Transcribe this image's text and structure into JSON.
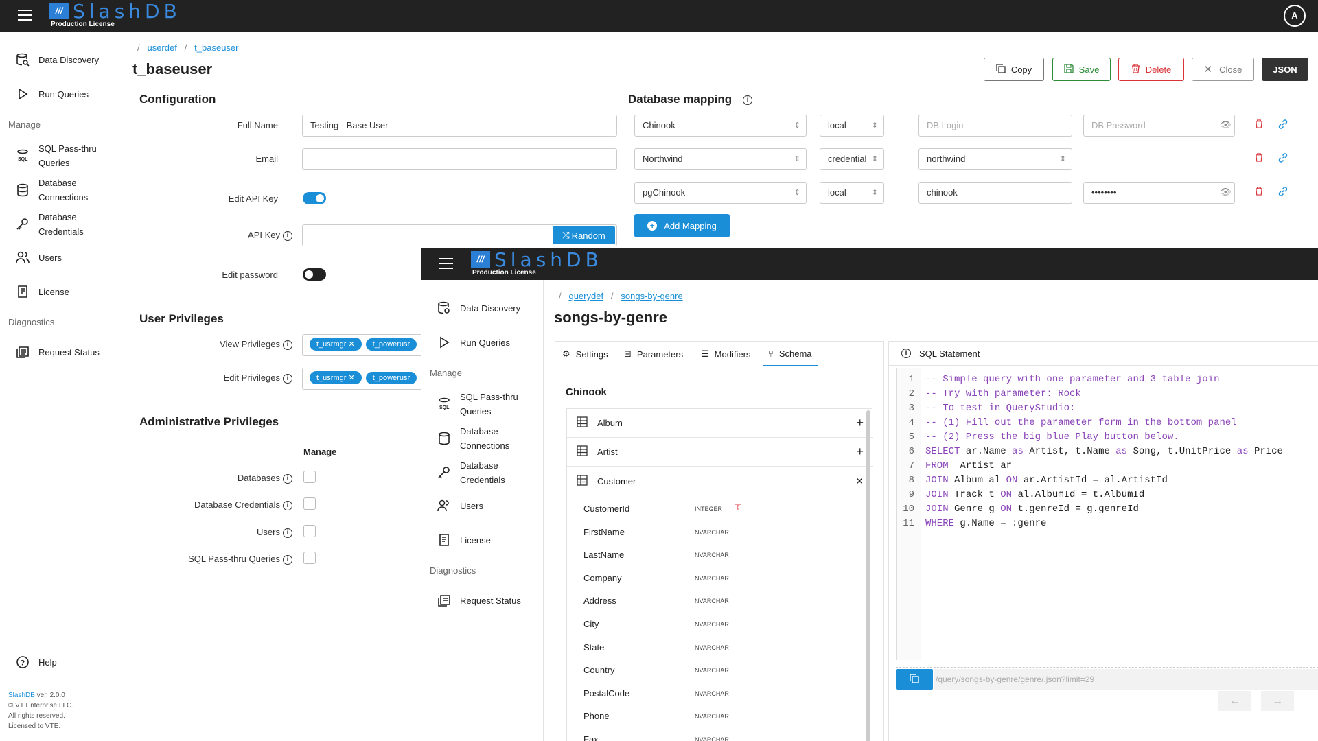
{
  "app": {
    "name": "SlashDB",
    "license": "Production License",
    "avatar": "A"
  },
  "sidebar": {
    "items": [
      {
        "label": "Data Discovery"
      },
      {
        "label": "Run Queries"
      },
      {
        "label": "SQL Pass-thru Queries"
      },
      {
        "label": "Database Connections"
      },
      {
        "label": "Database Credentials"
      },
      {
        "label": "Users"
      },
      {
        "label": "License"
      },
      {
        "label": "Request Status"
      },
      {
        "label": "Help"
      }
    ],
    "sections": {
      "manage": "Manage",
      "diagnostics": "Diagnostics"
    },
    "footer": {
      "product": "SlashDB",
      "version": " ver. 2.0.0",
      "copyright": "© VT Enterprise LLC.",
      "rights": "All rights reserved.",
      "licensed": "Licensed to VTE."
    }
  },
  "breadcrumb": {
    "sep": "/",
    "part1": "userdef",
    "part2": "t_baseuser"
  },
  "page_title": "t_baseuser",
  "toolbar": {
    "copy": "Copy",
    "save": "Save",
    "delete": "Delete",
    "close": "Close",
    "json": "JSON"
  },
  "config": {
    "heading": "Configuration",
    "full_name_label": "Full Name",
    "full_name_value": "Testing - Base User",
    "email_label": "Email",
    "email_value": "",
    "edit_api_key_label": "Edit API Key",
    "edit_api_key_on": true,
    "api_key_label": "API Key",
    "api_key_value": "",
    "random_label": "Random",
    "edit_password_label": "Edit password",
    "edit_password_on": false
  },
  "mapping": {
    "heading": "Database mapping",
    "rows": [
      {
        "db": "Chinook",
        "type": "local",
        "login": "",
        "login_ph": "DB Login",
        "password": "",
        "password_ph": "DB Password"
      },
      {
        "db": "Northwind",
        "type": "credential",
        "login": "northwind"
      },
      {
        "db": "pgChinook",
        "type": "local",
        "login": "chinook",
        "password": "••••••••"
      }
    ],
    "add_label": "Add Mapping"
  },
  "privileges": {
    "heading": "User Privileges",
    "view_label": "View Privileges",
    "edit_label": "Edit Privileges",
    "chips": [
      "t_usrmgr",
      "t_powerusr"
    ]
  },
  "admin": {
    "heading": "Administrative Privileges",
    "manage_col": "Manage",
    "rows": [
      {
        "label": "Databases",
        "checked": false
      },
      {
        "label": "Database Credentials",
        "checked": false
      },
      {
        "label": "Users",
        "checked": false
      },
      {
        "label": "SQL Pass-thru Queries",
        "checked": false
      }
    ]
  },
  "overlay": {
    "breadcrumb": {
      "sep": "/",
      "part1": "querydef",
      "part2": "songs-by-genre"
    },
    "title": "songs-by-genre",
    "tabs": [
      "Settings",
      "Parameters",
      "Modifiers",
      "Schema"
    ],
    "active_tab": "Schema",
    "schema": {
      "db": "Chinook",
      "tables": [
        "Album",
        "Artist",
        "Customer"
      ],
      "columns": [
        {
          "name": "CustomerId",
          "type": "INTEGER"
        },
        {
          "name": "FirstName",
          "type": "NVARCHAR"
        },
        {
          "name": "LastName",
          "type": "NVARCHAR"
        },
        {
          "name": "Company",
          "type": "NVARCHAR"
        },
        {
          "name": "Address",
          "type": "NVARCHAR"
        },
        {
          "name": "City",
          "type": "NVARCHAR"
        },
        {
          "name": "State",
          "type": "NVARCHAR"
        },
        {
          "name": "Country",
          "type": "NVARCHAR"
        },
        {
          "name": "PostalCode",
          "type": "NVARCHAR"
        },
        {
          "name": "Phone",
          "type": "NVARCHAR"
        },
        {
          "name": "Fax",
          "type": "NVARCHAR"
        }
      ]
    },
    "sql_heading": "SQL Statement",
    "sql_lines": [
      "-- Simple query with one parameter and 3 table join",
      "-- Try with parameter: Rock",
      "-- To test in QueryStudio:",
      "-- (1) Fill out the parameter form in the bottom panel",
      "-- (2) Press the big blue Play button below.",
      "SELECT ar.Name as Artist, t.Name as Song, t.UnitPrice as Price",
      "FROM  Artist ar",
      "JOIN Album al ON ar.ArtistId = al.ArtistId",
      "JOIN Track t ON al.AlbumId = t.AlbumId",
      "JOIN Genre g ON t.genreId = g.genreId",
      "WHERE g.Name = :genre"
    ],
    "url": "/query/songs-by-genre/genre/.json?limit=29"
  },
  "colors": {
    "accent": "#1a8fd8",
    "topbar": "#222222",
    "delete": "#d9343a",
    "save": "#2e8b3a"
  }
}
